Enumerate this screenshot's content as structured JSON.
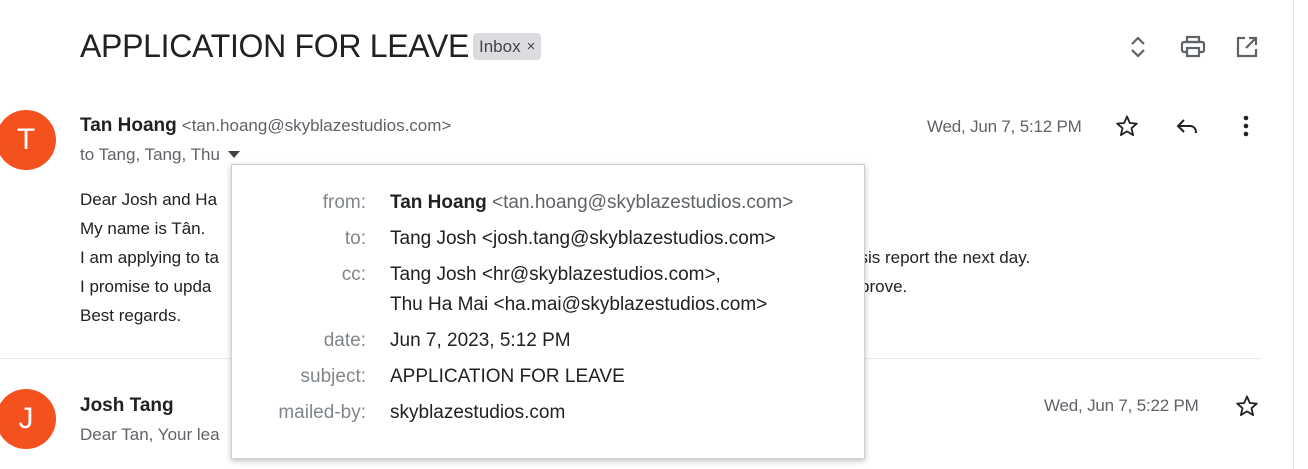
{
  "thread": {
    "subject": "APPLICATION FOR LEAVE",
    "label": "Inbox",
    "label_remove": "×",
    "toolbar_icons": [
      "expand-collapse-icon",
      "print-icon",
      "open-in-new-window-icon"
    ]
  },
  "message1": {
    "avatar_letter": "T",
    "avatar_color": "#f4511e",
    "sender_name": "Tan Hoang",
    "sender_email": "<tan.hoang@skyblazestudios.com>",
    "recipients": "to Tang, Tang, Thu",
    "date": "Wed, Jun 7, 5:12 PM",
    "body": [
      "Dear Josh and Ha",
      "My name is Tân.",
      "I am applying to ta",
      "I promise to upda",
      "Best regards."
    ],
    "body_tail": {
      "line3": "esis report the next day.",
      "line4": "prove."
    }
  },
  "message2": {
    "avatar_letter": "J",
    "avatar_color": "#f4511e",
    "sender_name": "Josh Tang",
    "snippet": "Dear Tan, Your lea",
    "date": "Wed, Jun 7, 5:22 PM"
  },
  "details_popup": {
    "from_label": "from:",
    "from_name": "Tan Hoang",
    "from_email": "<tan.hoang@skyblazestudios.com>",
    "to_label": "to:",
    "to_value": "Tang Josh <josh.tang@skyblazestudios.com>",
    "cc_label": "cc:",
    "cc_value_1": "Tang Josh <hr@skyblazestudios.com>,",
    "cc_value_2": "Thu Ha Mai <ha.mai@skyblazestudios.com>",
    "date_label": "date:",
    "date_value": "Jun 7, 2023, 5:12 PM",
    "subject_label": "subject:",
    "subject_value": "APPLICATION FOR LEAVE",
    "mailedby_label": "mailed-by:",
    "mailedby_value": "skyblazestudios.com"
  }
}
